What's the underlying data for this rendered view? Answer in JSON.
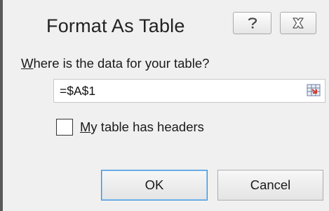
{
  "dialog": {
    "title": "Format As Table",
    "help_glyph": "?",
    "prompt_accel": "W",
    "prompt_rest": "here is the data for your table?",
    "range_value": "=$A$1",
    "checkbox_checked": false,
    "checkbox_accel": "M",
    "checkbox_rest": "y table has headers",
    "ok_label": "OK",
    "cancel_label": "Cancel"
  },
  "icons": {
    "help": "help-icon",
    "close": "close-icon",
    "collapse": "range-collapse-icon"
  },
  "colors": {
    "background": "#f0f0f0",
    "default_button_border": "#3c8fdc"
  }
}
